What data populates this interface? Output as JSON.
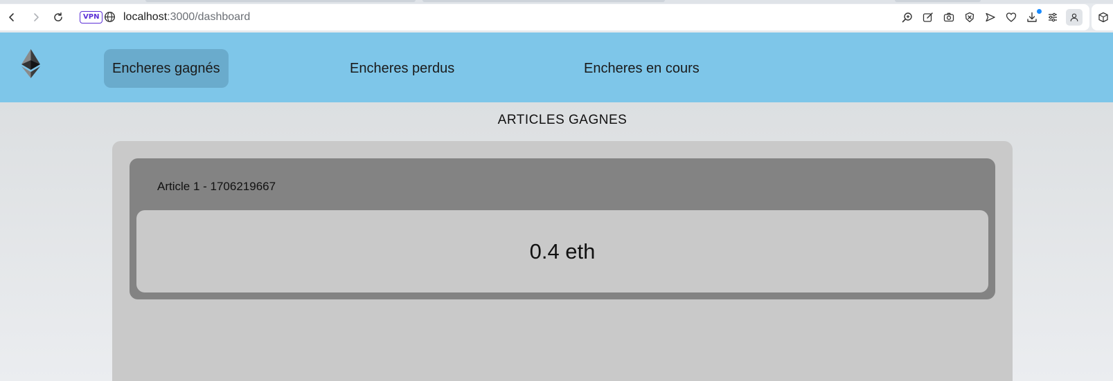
{
  "browser": {
    "vpn_label": "VPN",
    "url_host": "localhost",
    "url_path": ":3000/dashboard",
    "icons": [
      "back-icon",
      "forward-icon",
      "reload-icon",
      "globe-icon",
      "zoom-icon",
      "edit-icon",
      "camera-icon",
      "shield-icon",
      "send-icon",
      "heart-icon",
      "download-icon",
      "menu-icon",
      "profile-icon",
      "extension-icon"
    ],
    "accent_color": "#5b2fd6"
  },
  "navbar": {
    "logo": "ethereum-icon",
    "links": [
      {
        "label": "Encheres gagnés",
        "active": true
      },
      {
        "label": "Encheres perdus",
        "active": false
      },
      {
        "label": "Encheres en cours",
        "active": false
      }
    ],
    "background_color": "#7ec6e9"
  },
  "main": {
    "section_title": "ARTICLES GAGNES",
    "articles": [
      {
        "title": "Article 1 - 1706219667",
        "price": "0.4 eth"
      }
    ]
  }
}
